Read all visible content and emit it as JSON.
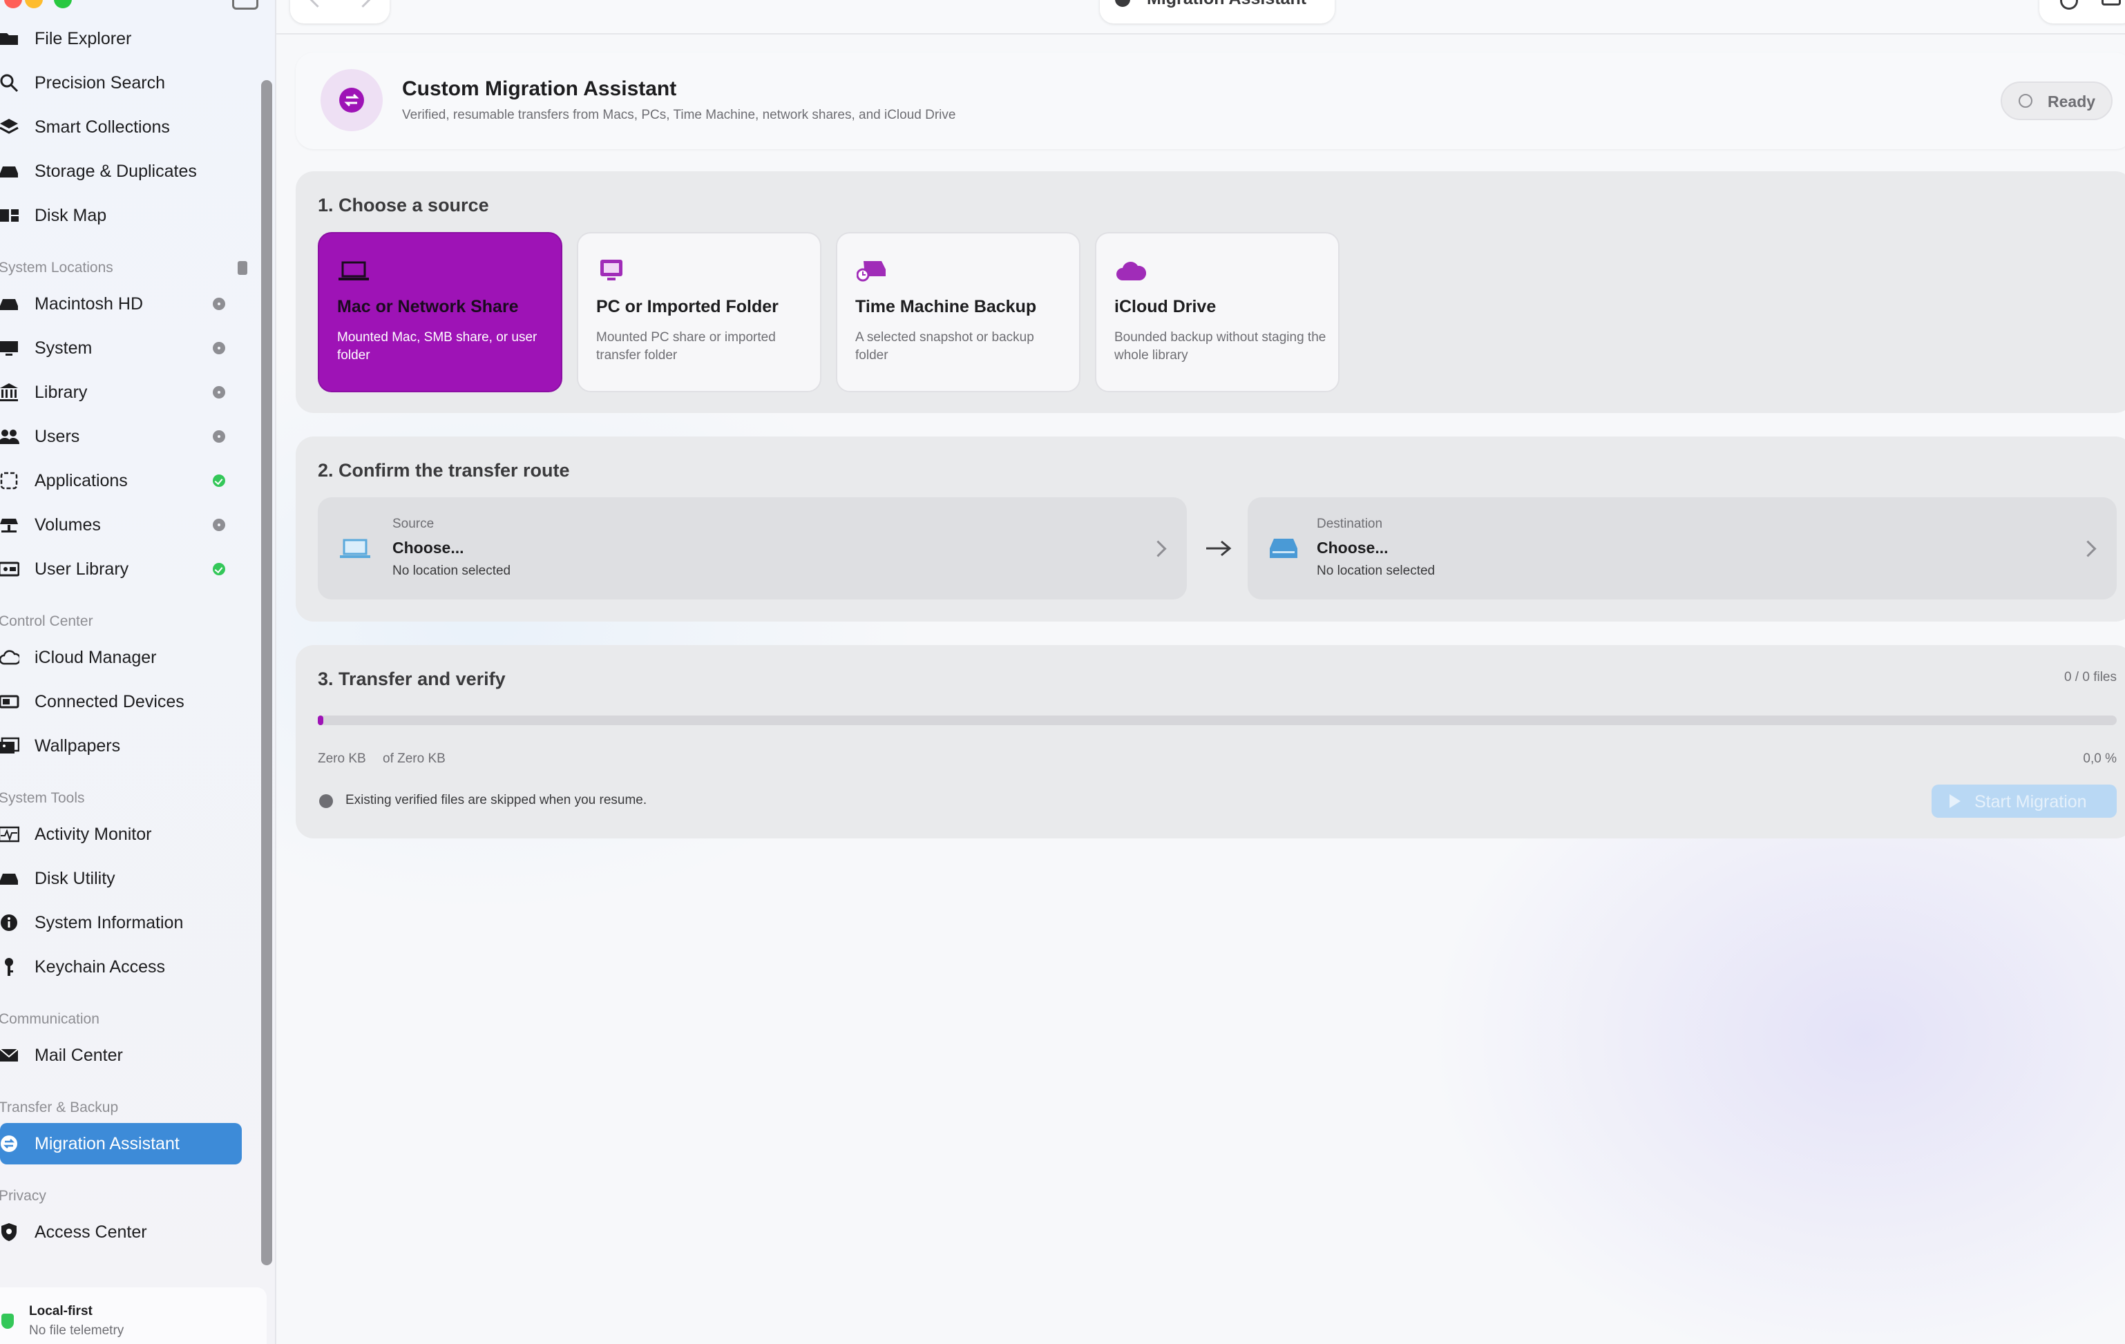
{
  "window": {
    "title": "Migration Assistant"
  },
  "sidebar": {
    "top_items": [
      {
        "label": "File Explorer"
      },
      {
        "label": "Precision Search"
      },
      {
        "label": "Smart Collections"
      },
      {
        "label": "Storage & Duplicates"
      },
      {
        "label": "Disk Map"
      }
    ],
    "sections": {
      "system_locations": "System Locations",
      "control_center": "Control Center",
      "system_tools": "System Tools",
      "communication": "Communication",
      "transfer_backup": "Transfer & Backup",
      "privacy": "Privacy"
    },
    "system_locations": [
      {
        "label": "Macintosh HD",
        "status": "gray"
      },
      {
        "label": "System",
        "status": "gray"
      },
      {
        "label": "Library",
        "status": "gray"
      },
      {
        "label": "Users",
        "status": "gray"
      },
      {
        "label": "Applications",
        "status": "green"
      },
      {
        "label": "Volumes",
        "status": "gray"
      },
      {
        "label": "User Library",
        "status": "green"
      }
    ],
    "control_center": [
      {
        "label": "iCloud Manager"
      },
      {
        "label": "Connected Devices"
      },
      {
        "label": "Wallpapers"
      }
    ],
    "system_tools": [
      {
        "label": "Activity Monitor"
      },
      {
        "label": "Disk Utility"
      },
      {
        "label": "System Information"
      },
      {
        "label": "Keychain Access"
      }
    ],
    "communication": [
      {
        "label": "Mail Center"
      }
    ],
    "transfer_backup": [
      {
        "label": "Migration Assistant",
        "active": true
      }
    ],
    "privacy": [
      {
        "label": "Access Center"
      }
    ],
    "footer": {
      "title": "Local-first",
      "subtitle": "No file telemetry"
    }
  },
  "header": {
    "title": "Custom Migration Assistant",
    "subtitle": "Verified, resumable transfers from Macs, PCs, Time Machine, network shares, and iCloud Drive",
    "status": "Ready"
  },
  "step1": {
    "title": "1. Choose a source",
    "sources": [
      {
        "title": "Mac or Network Share",
        "desc": "Mounted Mac, SMB share, or user folder",
        "selected": true,
        "icon": "laptop-icon"
      },
      {
        "title": "PC or Imported Folder",
        "desc": "Mounted PC share or imported transfer folder",
        "icon": "monitor-icon"
      },
      {
        "title": "Time Machine Backup",
        "desc": "A selected snapshot or backup folder",
        "icon": "time-machine-icon"
      },
      {
        "title": "iCloud Drive",
        "desc": "Bounded backup without staging the whole library",
        "icon": "cloud-icon"
      }
    ]
  },
  "step2": {
    "title": "2. Confirm the transfer route",
    "source": {
      "label": "Source",
      "value": "Choose...",
      "sub": "No location selected"
    },
    "destination": {
      "label": "Destination",
      "value": "Choose...",
      "sub": "No location selected"
    }
  },
  "step3": {
    "title": "3. Transfer and verify",
    "files_count": "0 / 0 files",
    "progress": 0,
    "size_done": "Zero KB",
    "size_total": "of Zero KB",
    "percent": "0,0 %",
    "note": "Existing verified files are skipped when you resume.",
    "start_button": "Start Migration"
  },
  "colors": {
    "accent": "#9e13b6",
    "selection": "#3d8bd8",
    "green": "#34c759"
  }
}
